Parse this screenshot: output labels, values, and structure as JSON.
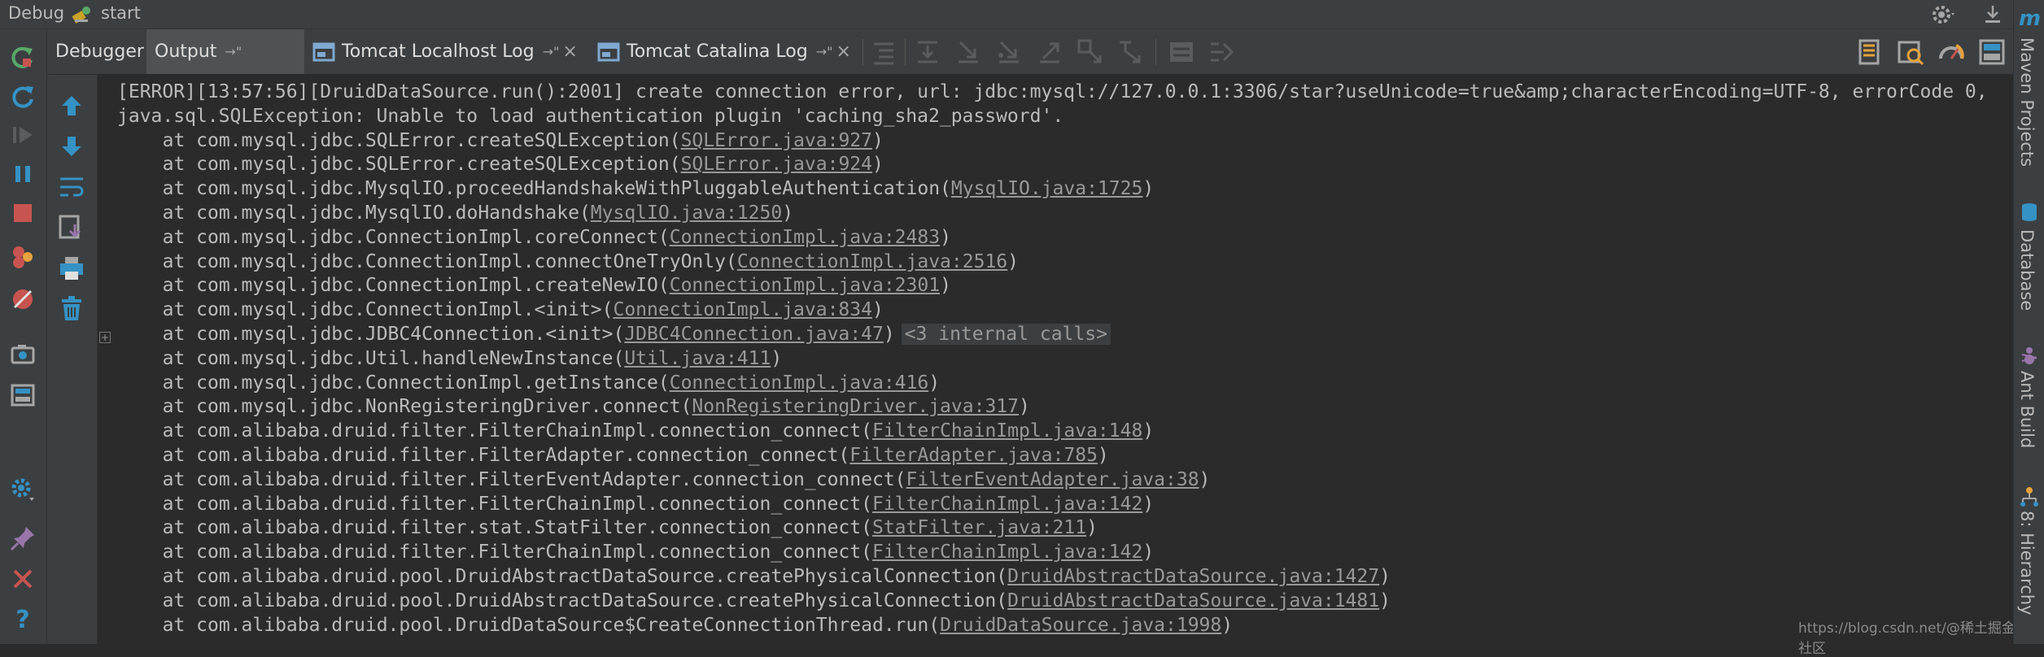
{
  "titlebar": {
    "debug_label": "Debug",
    "config_label": "start"
  },
  "tabs": [
    {
      "label": "Debugger",
      "icon": "none",
      "pinned": false,
      "closable": false,
      "active": false
    },
    {
      "label": "Output",
      "icon": "none",
      "pinned": true,
      "closable": false,
      "active": true
    },
    {
      "label": "Tomcat Localhost Log",
      "icon": "log-window-icon",
      "pinned": true,
      "closable": true,
      "active": false
    },
    {
      "label": "Tomcat Catalina Log",
      "icon": "log-window-icon",
      "pinned": true,
      "closable": true,
      "active": false
    }
  ],
  "tab_symbols": {
    "pin": "→\"",
    "close": "×"
  },
  "right_panels": [
    "Maven Projects",
    "Database",
    "Ant Build",
    "8: Hierarchy"
  ],
  "right_logo": "m",
  "console": {
    "lines": [
      {
        "indent": 0,
        "text": "[ERROR][13:57:56][DruidDataSource.run():2001] create connection error, url: jdbc:mysql://127.0.0.1:3306/star?useUnicode=true&amp;characterEncoding=UTF-8, errorCode 0,"
      },
      {
        "indent": 0,
        "text": "java.sql.SQLException: Unable to load authentication plugin 'caching_sha2_password'."
      },
      {
        "indent": 4,
        "text": "at com.mysql.jdbc.SQLError.createSQLException(",
        "link": "SQLError.java:927",
        "after": ")"
      },
      {
        "indent": 4,
        "text": "at com.mysql.jdbc.SQLError.createSQLException(",
        "link": "SQLError.java:924",
        "after": ")"
      },
      {
        "indent": 4,
        "text": "at com.mysql.jdbc.MysqlIO.proceedHandshakeWithPluggableAuthentication(",
        "link": "MysqlIO.java:1725",
        "after": ")"
      },
      {
        "indent": 4,
        "text": "at com.mysql.jdbc.MysqlIO.doHandshake(",
        "link": "MysqlIO.java:1250",
        "after": ")"
      },
      {
        "indent": 4,
        "text": "at com.mysql.jdbc.ConnectionImpl.coreConnect(",
        "link": "ConnectionImpl.java:2483",
        "after": ")"
      },
      {
        "indent": 4,
        "text": "at com.mysql.jdbc.ConnectionImpl.connectOneTryOnly(",
        "link": "ConnectionImpl.java:2516",
        "after": ")"
      },
      {
        "indent": 4,
        "text": "at com.mysql.jdbc.ConnectionImpl.createNewIO(",
        "link": "ConnectionImpl.java:2301",
        "after": ")"
      },
      {
        "indent": 4,
        "text": "at com.mysql.jdbc.ConnectionImpl.<init>(",
        "link": "ConnectionImpl.java:834",
        "after": ")"
      },
      {
        "indent": 4,
        "text": "at com.mysql.jdbc.JDBC4Connection.<init>(",
        "link": "JDBC4Connection.java:47",
        "after": ")",
        "badge": "<3 internal calls>"
      },
      {
        "indent": 4,
        "text": "at com.mysql.jdbc.Util.handleNewInstance(",
        "link": "Util.java:411",
        "after": ")"
      },
      {
        "indent": 4,
        "text": "at com.mysql.jdbc.ConnectionImpl.getInstance(",
        "link": "ConnectionImpl.java:416",
        "after": ")"
      },
      {
        "indent": 4,
        "text": "at com.mysql.jdbc.NonRegisteringDriver.connect(",
        "link": "NonRegisteringDriver.java:317",
        "after": ")"
      },
      {
        "indent": 4,
        "text": "at com.alibaba.druid.filter.FilterChainImpl.connection_connect(",
        "link": "FilterChainImpl.java:148",
        "after": ")"
      },
      {
        "indent": 4,
        "text": "at com.alibaba.druid.filter.FilterAdapter.connection_connect(",
        "link": "FilterAdapter.java:785",
        "after": ")"
      },
      {
        "indent": 4,
        "text": "at com.alibaba.druid.filter.FilterEventAdapter.connection_connect(",
        "link": "FilterEventAdapter.java:38",
        "after": ")"
      },
      {
        "indent": 4,
        "text": "at com.alibaba.druid.filter.FilterChainImpl.connection_connect(",
        "link": "FilterChainImpl.java:142",
        "after": ")"
      },
      {
        "indent": 4,
        "text": "at com.alibaba.druid.filter.stat.StatFilter.connection_connect(",
        "link": "StatFilter.java:211",
        "after": ")"
      },
      {
        "indent": 4,
        "text": "at com.alibaba.druid.filter.FilterChainImpl.connection_connect(",
        "link": "FilterChainImpl.java:142",
        "after": ")"
      },
      {
        "indent": 4,
        "text": "at com.alibaba.druid.pool.DruidAbstractDataSource.createPhysicalConnection(",
        "link": "DruidAbstractDataSource.java:1427",
        "after": ")"
      },
      {
        "indent": 4,
        "text": "at com.alibaba.druid.pool.DruidAbstractDataSource.createPhysicalConnection(",
        "link": "DruidAbstractDataSource.java:1481",
        "after": ")"
      },
      {
        "indent": 4,
        "text": "at com.alibaba.druid.pool.DruidDataSource$CreateConnectionThread.run(",
        "link": "DruidDataSource.java:1998",
        "after": ")"
      }
    ]
  },
  "watermark": "https://blog.csdn.net/@稀土掘金技术社区",
  "colors": {
    "panel_bg": "#3c3f41",
    "console_bg": "#2b2b2b",
    "text": "#bbbbbb",
    "rerun_green": "#59a869",
    "stop_red": "#c75450",
    "blue_icon": "#3592c4"
  }
}
